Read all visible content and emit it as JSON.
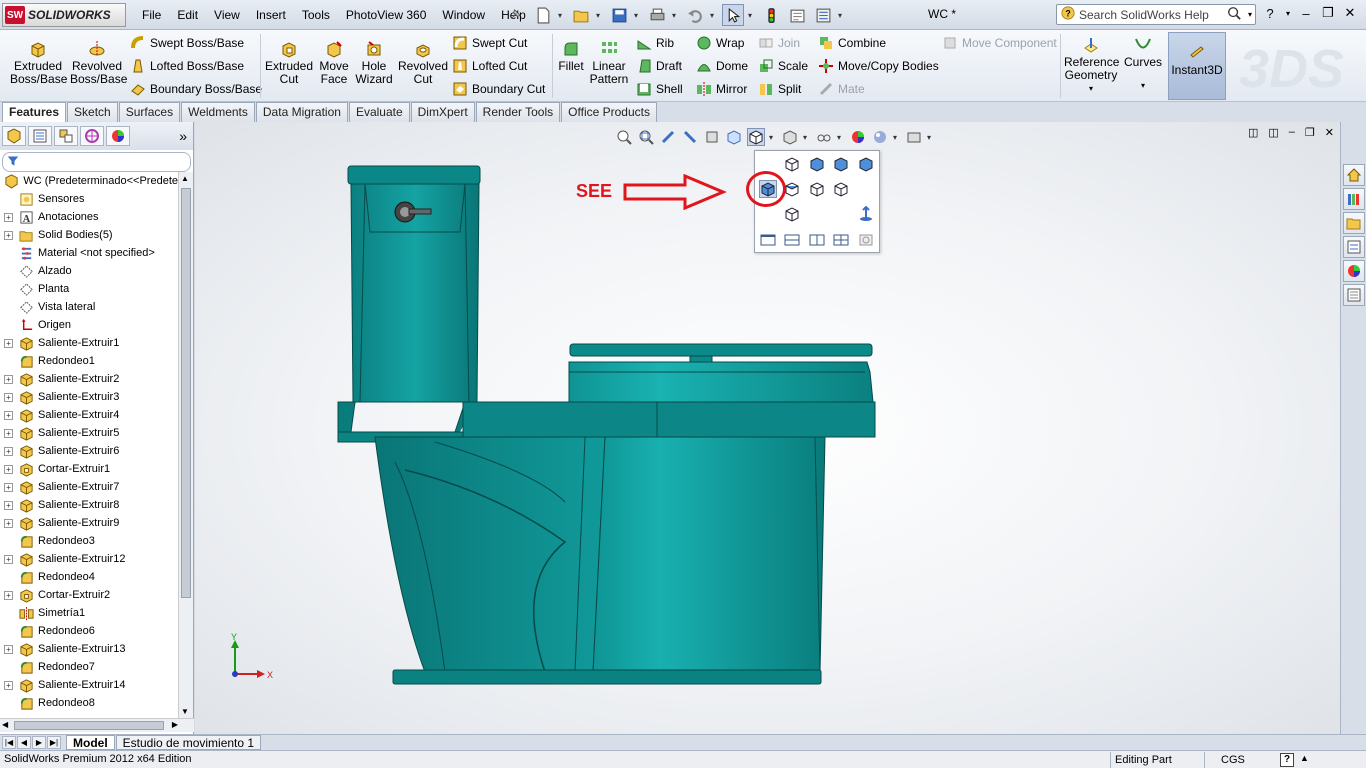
{
  "app": {
    "brand": "SOLIDWORKS",
    "doc_title": "WC *"
  },
  "menu": [
    "File",
    "Edit",
    "View",
    "Insert",
    "Tools",
    "PhotoView 360",
    "Window",
    "Help"
  ],
  "search": {
    "placeholder": "Search SolidWorks Help"
  },
  "ribbon": {
    "extruded_boss": "Extruded Boss/Base",
    "revolved_boss": "Revolved Boss/Base",
    "swept_boss": "Swept Boss/Base",
    "lofted_boss": "Lofted Boss/Base",
    "boundary_boss": "Boundary Boss/Base",
    "extruded_cut": "Extruded Cut",
    "move_face": "Move Face",
    "hole_wizard": "Hole Wizard",
    "revolved_cut": "Revolved Cut",
    "swept_cut": "Swept Cut",
    "lofted_cut": "Lofted Cut",
    "boundary_cut": "Boundary Cut",
    "fillet": "Fillet",
    "linear_pattern": "Linear Pattern",
    "rib": "Rib",
    "draft": "Draft",
    "shell": "Shell",
    "wrap": "Wrap",
    "dome": "Dome",
    "mirror": "Mirror",
    "join": "Join",
    "scale": "Scale",
    "split": "Split",
    "combine": "Combine",
    "move_copy_bodies": "Move/Copy Bodies",
    "mate": "Mate",
    "move_component": "Move Component",
    "reference_geometry": "Reference Geometry",
    "curves": "Curves",
    "instant3d": "Instant3D"
  },
  "tabs": [
    "Features",
    "Sketch",
    "Surfaces",
    "Weldments",
    "Data Migration",
    "Evaluate",
    "DimXpert",
    "Render Tools",
    "Office Products"
  ],
  "tree": {
    "root": "WC  (Predeterminado<<Predete",
    "items": [
      {
        "label": "Sensores",
        "exp": false,
        "icon": "sensor"
      },
      {
        "label": "Anotaciones",
        "exp": true,
        "icon": "annotation"
      },
      {
        "label": "Solid Bodies(5)",
        "exp": true,
        "icon": "folder"
      },
      {
        "label": "Material <not specified>",
        "exp": false,
        "icon": "material"
      },
      {
        "label": "Alzado",
        "exp": false,
        "icon": "plane"
      },
      {
        "label": "Planta",
        "exp": false,
        "icon": "plane"
      },
      {
        "label": "Vista lateral",
        "exp": false,
        "icon": "plane"
      },
      {
        "label": "Origen",
        "exp": false,
        "icon": "origin"
      },
      {
        "label": "Saliente-Extruir1",
        "exp": true,
        "icon": "extrude"
      },
      {
        "label": "Redondeo1",
        "exp": false,
        "icon": "fillet"
      },
      {
        "label": "Saliente-Extruir2",
        "exp": true,
        "icon": "extrude"
      },
      {
        "label": "Saliente-Extruir3",
        "exp": true,
        "icon": "extrude"
      },
      {
        "label": "Saliente-Extruir4",
        "exp": true,
        "icon": "extrude"
      },
      {
        "label": "Saliente-Extruir5",
        "exp": true,
        "icon": "extrude"
      },
      {
        "label": "Saliente-Extruir6",
        "exp": true,
        "icon": "extrude"
      },
      {
        "label": "Cortar-Extruir1",
        "exp": true,
        "icon": "cut"
      },
      {
        "label": "Saliente-Extruir7",
        "exp": true,
        "icon": "extrude"
      },
      {
        "label": "Saliente-Extruir8",
        "exp": true,
        "icon": "extrude"
      },
      {
        "label": "Saliente-Extruir9",
        "exp": true,
        "icon": "extrude"
      },
      {
        "label": "Redondeo3",
        "exp": false,
        "icon": "fillet"
      },
      {
        "label": "Saliente-Extruir12",
        "exp": true,
        "icon": "extrude"
      },
      {
        "label": "Redondeo4",
        "exp": false,
        "icon": "fillet"
      },
      {
        "label": "Cortar-Extruir2",
        "exp": true,
        "icon": "cut"
      },
      {
        "label": "Simetría1",
        "exp": false,
        "icon": "mirror"
      },
      {
        "label": "Redondeo6",
        "exp": false,
        "icon": "fillet"
      },
      {
        "label": "Saliente-Extruir13",
        "exp": true,
        "icon": "extrude"
      },
      {
        "label": "Redondeo7",
        "exp": false,
        "icon": "fillet"
      },
      {
        "label": "Saliente-Extruir14",
        "exp": true,
        "icon": "extrude"
      },
      {
        "label": "Redondeo8",
        "exp": false,
        "icon": "fillet"
      }
    ]
  },
  "annotation": {
    "text": "SEE",
    "color": "#e1161c"
  },
  "triad": {
    "x": "X",
    "y": "Y"
  },
  "bottom_tabs": [
    "Model",
    "Estudio de movimiento 1"
  ],
  "status": {
    "edition": "SolidWorks Premium 2012 x64 Edition",
    "mode": "Editing Part",
    "units": "CGS",
    "help": "?"
  },
  "colors": {
    "model": "#0e8c8c",
    "model_edge": "#074c4c",
    "accent": "#c9d6ea"
  }
}
